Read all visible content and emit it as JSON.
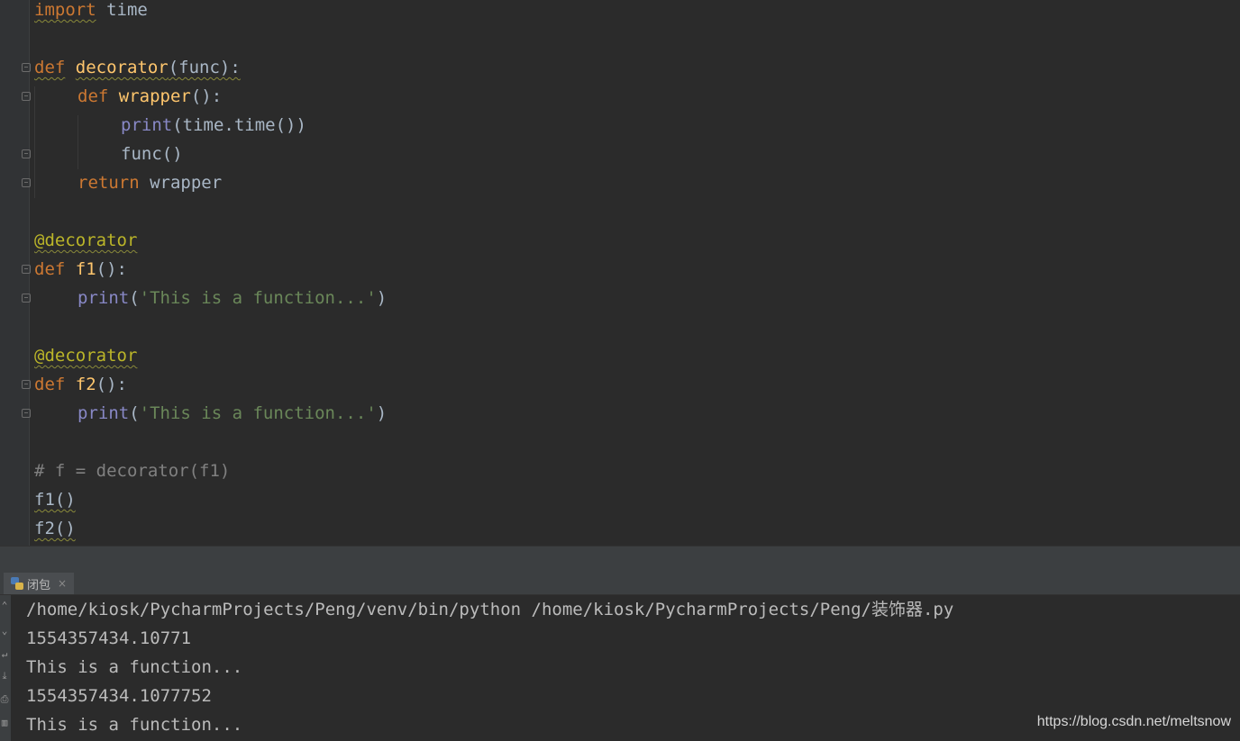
{
  "code": {
    "line1": {
      "kw": "import",
      "rest": " time"
    },
    "line3": {
      "kw": "def",
      "name": "decorator",
      "args": "(func):"
    },
    "line4": {
      "kw": "def",
      "name": "wrapper",
      "args": "():"
    },
    "line5": {
      "bi": "print",
      "rest": "(time.time())"
    },
    "line6": {
      "text": "func()"
    },
    "line7": {
      "kw": "return",
      "rest": " wrapper"
    },
    "line9": {
      "deco": "@decorator"
    },
    "line10": {
      "kw": "def",
      "name": "f1",
      "args": "():"
    },
    "line11": {
      "bi": "print",
      "open": "(",
      "str": "'This is a function...'",
      "close": ")"
    },
    "line13": {
      "deco": "@decorator"
    },
    "line14": {
      "kw": "def",
      "name": "f2",
      "args": "():"
    },
    "line15": {
      "bi": "print",
      "open": "(",
      "str": "'This is a function...'",
      "close": ")"
    },
    "line17": {
      "comment": "# f = decorator(f1)"
    },
    "line18": {
      "text": "f1()"
    },
    "line19": {
      "text": "f2()"
    }
  },
  "run_panel": {
    "tab_label": "闭包",
    "close": "×",
    "output": [
      "/home/kiosk/PycharmProjects/Peng/venv/bin/python /home/kiosk/PycharmProjects/Peng/装饰器.py",
      "1554357434.10771",
      "This is a function...",
      "1554357434.1077752",
      "This is a function..."
    ]
  },
  "watermark": "https://blog.csdn.net/meltsnow"
}
